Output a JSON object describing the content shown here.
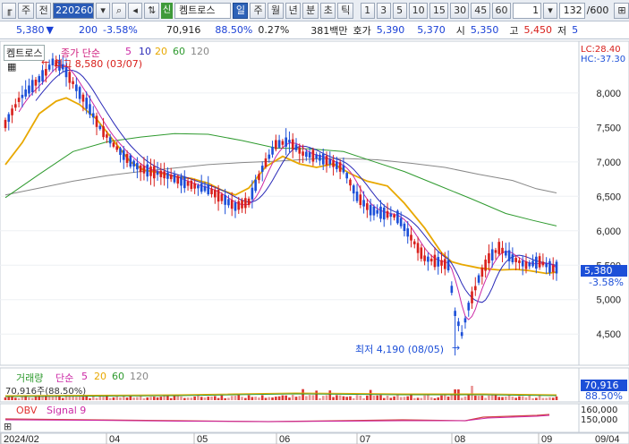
{
  "toolbar": {
    "type_label": "주",
    "prev_label": "전",
    "code": "220260",
    "name_icon": "신",
    "name": "켐트로스",
    "period_buttons": [
      "일",
      "주",
      "월",
      "년",
      "분",
      "초",
      "틱"
    ],
    "active_period": "일",
    "intervals": [
      "1",
      "3",
      "5",
      "10",
      "15",
      "30",
      "45",
      "60"
    ],
    "unit_value": "1",
    "count": "132",
    "total": "/600"
  },
  "quote": {
    "price": "5,380",
    "change": "200",
    "change_pct": "-3.58%",
    "volume": "70,916",
    "vol_ratio": "88.50%",
    "turnover": "0.27%",
    "amount": "381백만",
    "bid_label": "호가",
    "ask": "5,390",
    "bid": "5,370",
    "open_label": "시",
    "open": "5,350",
    "high_label": "고",
    "high": "5,450",
    "low_label": "저",
    "low": "5"
  },
  "price_pane": {
    "stock_name": "켐트로스",
    "ma_label": "종가 단순",
    "ma_periods": [
      "5",
      "10",
      "20",
      "60",
      "120"
    ],
    "lc_label": "LC:28.40",
    "hc_label": "HC:-37.30",
    "high_annot": "최고 8,580 (03/07)",
    "low_annot": "최저 4,190 (08/05)",
    "last_price": "5,380",
    "last_change": "-3.58%",
    "y_ticks": [
      "8,000",
      "7,500",
      "7,000",
      "6,500",
      "6,000",
      "5,500",
      "5,000",
      "4,500"
    ]
  },
  "volume_pane": {
    "label": "거래량",
    "ma_label": "단순",
    "ma_periods": [
      "5",
      "20",
      "60",
      "120"
    ],
    "value_text": "70,916주(88.50%)",
    "last_value": "70,916",
    "last_pct": "88.50%"
  },
  "obv_pane": {
    "label": "OBV",
    "signal_label": "Signal 9",
    "ticks": [
      "160,000",
      "150,000"
    ]
  },
  "x_axis": [
    "2024/02",
    "04",
    "05",
    "06",
    "07",
    "08",
    "09",
    "09/04"
  ],
  "colors": {
    "up": "#d8201c",
    "down": "#1c4fd8",
    "ma5": "#cc2aa6",
    "ma10": "#2a2ab8",
    "ma20": "#e8a800",
    "ma60": "#2e9a2e",
    "ma120": "#888888"
  },
  "chart_data": {
    "type": "candlestick",
    "y_range": [
      4100,
      8700
    ],
    "high": {
      "value": 8580,
      "date": "03/07"
    },
    "low": {
      "value": 4190,
      "date": "08/05"
    },
    "last": 5380,
    "ma20_path": [
      [
        0,
        6960
      ],
      [
        5,
        7280
      ],
      [
        10,
        7700
      ],
      [
        15,
        7880
      ],
      [
        18,
        7930
      ],
      [
        22,
        7830
      ],
      [
        27,
        7620
      ],
      [
        32,
        7310
      ],
      [
        37,
        7000
      ],
      [
        41,
        6880
      ],
      [
        46,
        6840
      ],
      [
        51,
        6780
      ],
      [
        55,
        6760
      ],
      [
        60,
        6690
      ],
      [
        64,
        6590
      ],
      [
        68,
        6520
      ],
      [
        72,
        6620
      ],
      [
        77,
        6930
      ],
      [
        82,
        7080
      ],
      [
        87,
        6970
      ],
      [
        92,
        6920
      ],
      [
        97,
        6970
      ],
      [
        102,
        6830
      ],
      [
        107,
        6720
      ],
      [
        113,
        6650
      ],
      [
        118,
        6400
      ],
      [
        124,
        6040
      ],
      [
        129,
        5680
      ],
      [
        132,
        5550
      ],
      [
        135,
        5510
      ],
      [
        140,
        5460
      ],
      [
        146,
        5430
      ],
      [
        151,
        5440
      ],
      [
        155,
        5420
      ],
      [
        160,
        5380
      ],
      [
        163,
        5400
      ]
    ],
    "ma60_path": [
      [
        0,
        6480
      ],
      [
        10,
        6820
      ],
      [
        20,
        7150
      ],
      [
        30,
        7290
      ],
      [
        40,
        7360
      ],
      [
        50,
        7410
      ],
      [
        60,
        7400
      ],
      [
        70,
        7310
      ],
      [
        80,
        7200
      ],
      [
        90,
        7190
      ],
      [
        100,
        7150
      ],
      [
        108,
        7020
      ],
      [
        118,
        6860
      ],
      [
        128,
        6660
      ],
      [
        138,
        6460
      ],
      [
        148,
        6250
      ],
      [
        156,
        6150
      ],
      [
        163,
        6070
      ]
    ],
    "ma120_path": [
      [
        0,
        6520
      ],
      [
        10,
        6620
      ],
      [
        20,
        6720
      ],
      [
        30,
        6800
      ],
      [
        40,
        6860
      ],
      [
        50,
        6910
      ],
      [
        60,
        6960
      ],
      [
        70,
        6990
      ],
      [
        80,
        7010
      ],
      [
        90,
        7040
      ],
      [
        100,
        7050
      ],
      [
        110,
        7030
      ],
      [
        120,
        6980
      ],
      [
        130,
        6920
      ],
      [
        140,
        6820
      ],
      [
        150,
        6730
      ],
      [
        157,
        6610
      ],
      [
        163,
        6550
      ]
    ]
  }
}
